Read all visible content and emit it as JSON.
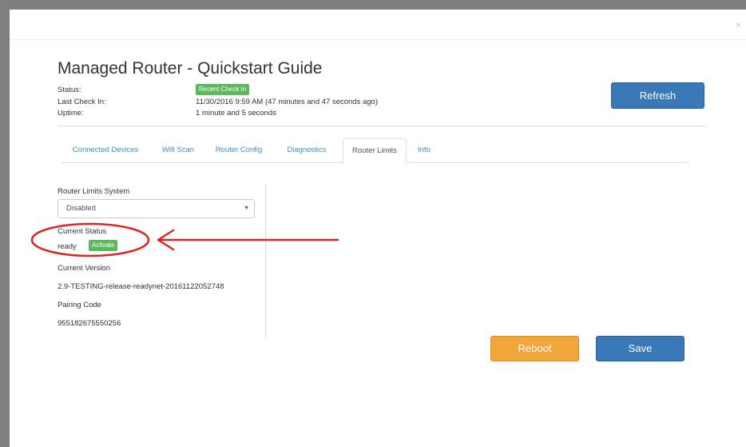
{
  "modal": {
    "close_glyph": "×",
    "title": "Managed Router - Quickstart Guide"
  },
  "info": {
    "status_label": "Status:",
    "status_badge": "Recent Check In",
    "last_checkin_label": "Last Check In:",
    "last_checkin_value": "11/30/2016 9:59 AM (47 minutes and 47 seconds ago)",
    "uptime_label": "Uptime:",
    "uptime_value": "1 minute and 5 seconds"
  },
  "buttons": {
    "refresh": "Refresh",
    "reboot": "Reboot",
    "save": "Save"
  },
  "tabs": [
    {
      "label": "Connected Devices",
      "active": false
    },
    {
      "label": "Wifi Scan",
      "active": false
    },
    {
      "label": "Router Config",
      "active": false
    },
    {
      "label": "Diagnostics",
      "active": false
    },
    {
      "label": "Router Limits",
      "active": true
    },
    {
      "label": "Info",
      "active": false
    }
  ],
  "router_limits": {
    "system_label": "Router Limits System",
    "system_selected": "Disabled",
    "current_status_label": "Current Status",
    "current_status_value": "ready",
    "activate_label": "Activate",
    "current_version_label": "Current Version",
    "current_version_value": "2.9-TESTING-release-readynet-20161122052748",
    "pairing_code_label": "Pairing Code",
    "pairing_code_value": "955182675550256"
  },
  "colors": {
    "primary": "#3a78b8",
    "warning": "#f0a63b",
    "success": "#5cb85c",
    "link": "#428bca",
    "annotation": "#e02424"
  },
  "icons": {
    "close": "close-icon",
    "dropdown": "chevron-down-icon"
  }
}
